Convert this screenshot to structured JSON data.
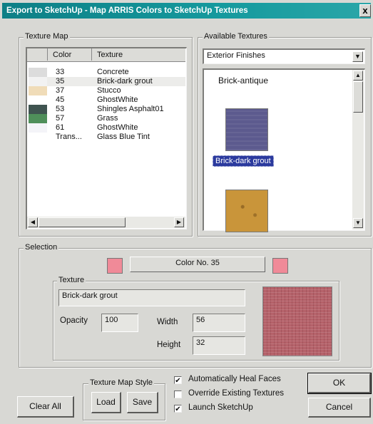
{
  "window": {
    "title": "Export to SketchUp - Map ARRIS Colors to SketchUp Textures",
    "close_label": "x"
  },
  "texture_map": {
    "legend": "Texture Map",
    "columns": [
      "Color",
      "Texture"
    ],
    "rows": [
      {
        "color": "33",
        "texture": "Concrete",
        "swatch": "#dcdcdc"
      },
      {
        "color": "35",
        "texture": "Brick-dark grout",
        "swatch": "#f2f2f2",
        "selected": true
      },
      {
        "color": "37",
        "texture": "Stucco",
        "swatch": "#f0dcb8"
      },
      {
        "color": "45",
        "texture": "GhostWhite",
        "swatch": "#ffffff"
      },
      {
        "color": "53",
        "texture": "Shingles Asphalt01",
        "swatch": "#3f5450"
      },
      {
        "color": "57",
        "texture": "Grass",
        "swatch": "#4f8f5a"
      },
      {
        "color": "61",
        "texture": "GhostWhite",
        "swatch": "#f4f4f8"
      },
      {
        "color": "Trans...",
        "texture": "Glass Blue Tint",
        "swatch": "#ffffff"
      }
    ]
  },
  "available_textures": {
    "legend": "Available Textures",
    "category": "Exterior Finishes",
    "items": [
      {
        "label": "Brick-antique",
        "swatch": null
      },
      {
        "label": "Brick-dark grout",
        "swatch": "#5c5a8e",
        "selected": true
      },
      {
        "label": "",
        "swatch": "#c9953a"
      }
    ]
  },
  "selection": {
    "legend": "Selection",
    "color_label": "Color No. 35",
    "color_hex": "#f08a98",
    "texture": {
      "legend": "Texture",
      "name": "Brick-dark grout",
      "opacity_label": "Opacity",
      "opacity": "100",
      "width_label": "Width",
      "width": "56",
      "height_label": "Height",
      "height": "32",
      "preview_color": "#b5626a"
    }
  },
  "texture_map_style": {
    "legend": "Texture Map Style",
    "load": "Load",
    "save": "Save"
  },
  "options": [
    {
      "label": "Automatically Heal Faces",
      "checked": true
    },
    {
      "label": "Override Existing Textures",
      "checked": false
    },
    {
      "label": "Launch SketchUp",
      "checked": true
    }
  ],
  "buttons": {
    "clear_all": "Clear All",
    "ok": "OK",
    "cancel": "Cancel"
  },
  "colors": {
    "title_bar": "#0e7f86",
    "highlight": "#2b3a9e"
  }
}
